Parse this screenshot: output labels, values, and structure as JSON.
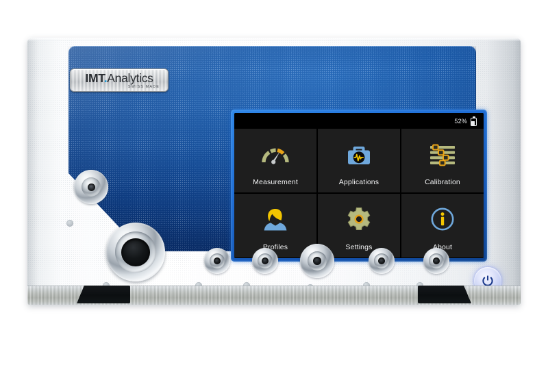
{
  "device": {
    "brand_main": "IMT",
    "brand_dot": ".",
    "brand_secondary": "Analytics",
    "brand_sub": "SWISS MADE",
    "power_button_label": "Power",
    "colors": {
      "panel_blue": "#1f5fae",
      "bezel_blue": "#1f6ed6",
      "screen_bg": "#000000",
      "tile_bg": "#1e1e1e",
      "accent_orange": "#e8a317",
      "accent_olive": "#b5b97e",
      "accent_yellow": "#f2c500",
      "accent_blue": "#6fa8dc",
      "text_light": "#f0f1f2"
    }
  },
  "screen": {
    "statusbar": {
      "battery_percent_label": "52%",
      "battery_level": 52,
      "battery_icon": "battery-icon"
    },
    "tiles": [
      {
        "id": "measurement",
        "label": "Measurement",
        "icon": "gauge-icon"
      },
      {
        "id": "applications",
        "label": "Applications",
        "icon": "medical-briefcase-icon"
      },
      {
        "id": "calibration",
        "label": "Calibration",
        "icon": "sliders-icon"
      },
      {
        "id": "profiles",
        "label": "Profiles",
        "icon": "user-profile-icon"
      },
      {
        "id": "settings",
        "label": "Settings",
        "icon": "gear-icon"
      },
      {
        "id": "about",
        "label": "About",
        "icon": "info-icon"
      }
    ]
  },
  "connectors": {
    "small_port_name": "small-chrome-connector",
    "flow_tube_name": "flow-tube-connector",
    "bottom_ports": [
      "port-1",
      "port-2",
      "port-3",
      "port-4",
      "port-5"
    ]
  }
}
